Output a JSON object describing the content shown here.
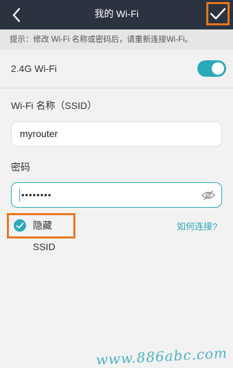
{
  "header": {
    "title": "我的 Wi-Fi",
    "back_icon": "chevron-left-icon",
    "confirm_icon": "checkmark-icon"
  },
  "hint": "提示：修改 Wi-Fi 名称或密码后，请重新连接Wi-Fi。",
  "band": {
    "label": "2.4G Wi-Fi",
    "enabled": true
  },
  "ssid": {
    "label": "Wi-Fi 名称（SSID）",
    "value": "myrouter"
  },
  "password": {
    "label": "密码",
    "masked_value": "••••••••",
    "eye_icon": "eye-hidden-icon"
  },
  "hide_ssid": {
    "label": "隐藏SSID",
    "checked": true
  },
  "help_link": "如何连接?",
  "watermark": "www.886abc.com",
  "colors": {
    "topbar": "#2b3340",
    "accent": "#2aa9b8",
    "highlight": "#e8761f",
    "background": "#f2f2f2"
  }
}
